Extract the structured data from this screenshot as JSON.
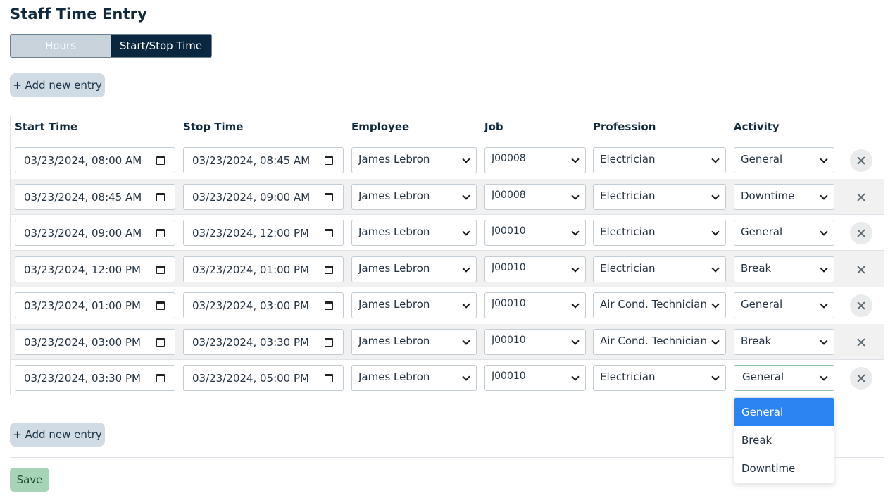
{
  "page": {
    "title": "Staff Time Entry"
  },
  "mode_toggle": {
    "options": [
      "Hours",
      "Start/Stop Time"
    ],
    "active": "Start/Stop Time"
  },
  "actions": {
    "add_entry_label": "+ Add new entry",
    "save_label": "Save"
  },
  "table": {
    "headers": {
      "start": "Start Time",
      "stop": "Stop Time",
      "employee": "Employee",
      "job": "Job",
      "profession": "Profession",
      "activity": "Activity"
    },
    "rows": [
      {
        "start": "03/23/2024, 08:00 AM",
        "stop": "03/23/2024, 08:45 AM",
        "employee": "James Lebron",
        "job": "J00008",
        "profession": "Electrician",
        "activity": "General"
      },
      {
        "start": "03/23/2024, 08:45 AM",
        "stop": "03/23/2024, 09:00 AM",
        "employee": "James Lebron",
        "job": "J00008",
        "profession": "Electrician",
        "activity": "Downtime"
      },
      {
        "start": "03/23/2024, 09:00 AM",
        "stop": "03/23/2024, 12:00 PM",
        "employee": "James Lebron",
        "job": "J00010",
        "profession": "Electrician",
        "activity": "General"
      },
      {
        "start": "03/23/2024, 12:00 PM",
        "stop": "03/23/2024, 01:00 PM",
        "employee": "James Lebron",
        "job": "J00010",
        "profession": "Electrician",
        "activity": "Break"
      },
      {
        "start": "03/23/2024, 01:00 PM",
        "stop": "03/23/2024, 03:00 PM",
        "employee": "James Lebron",
        "job": "J00010",
        "profession": "Air Cond. Technician",
        "activity": "General"
      },
      {
        "start": "03/23/2024, 03:00 PM",
        "stop": "03/23/2024, 03:30 PM",
        "employee": "James Lebron",
        "job": "J00010",
        "profession": "Air Cond. Technician",
        "activity": "Break"
      },
      {
        "start": "03/23/2024, 03:30 PM",
        "stop": "03/23/2024, 05:00 PM",
        "employee": "James Lebron",
        "job": "J00010",
        "profession": "Electrician",
        "activity": "General"
      }
    ]
  },
  "activity_dropdown": {
    "open": true,
    "options": [
      "General",
      "Break",
      "Downtime"
    ],
    "selected": "General"
  },
  "colors": {
    "toggle_active": "#0a2740",
    "toggle_inactive": "#c8d3dc",
    "add_button": "#d0dbe4",
    "save_button": "#a6d4b6",
    "dropdown_selected": "#2c83f2"
  }
}
